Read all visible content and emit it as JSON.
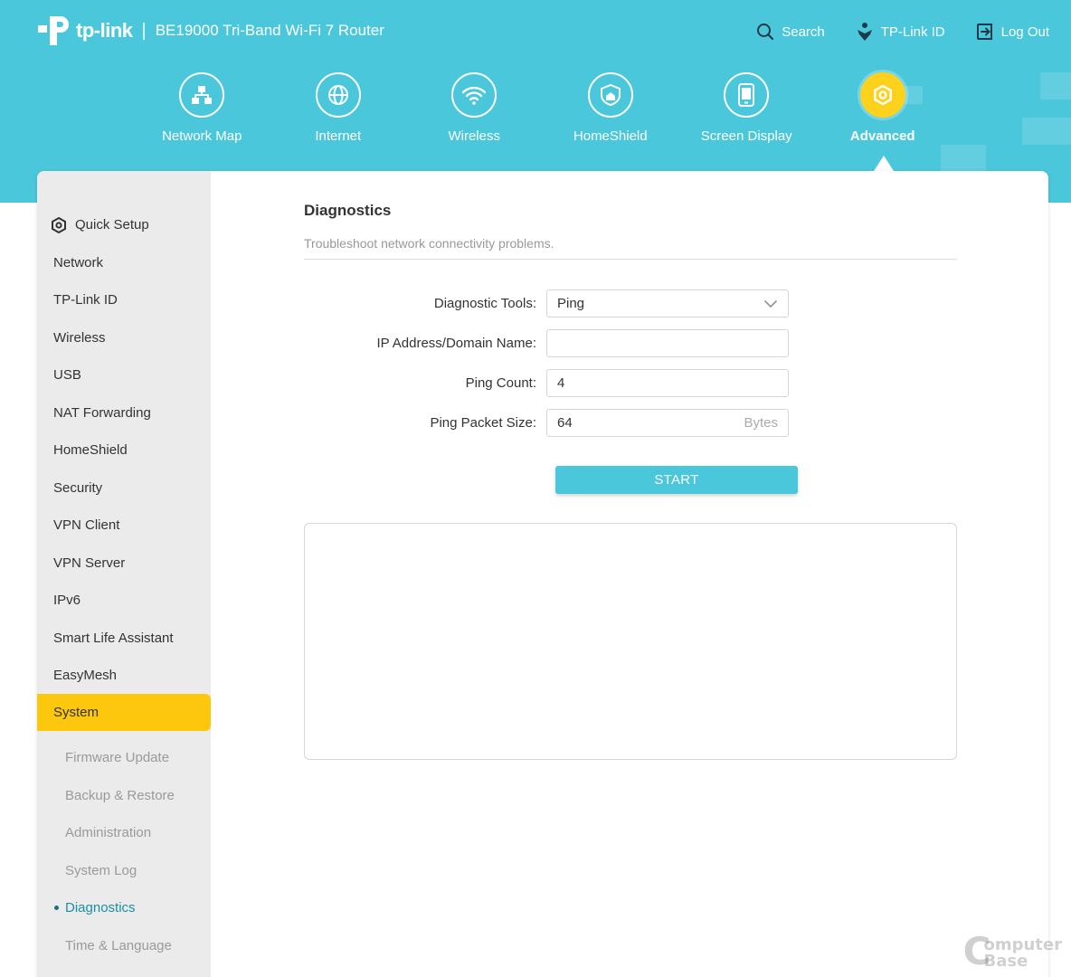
{
  "header": {
    "brand_name": "tp-link",
    "separator": "|",
    "model": "BE19000 Tri-Band Wi-Fi 7 Router",
    "links": [
      {
        "label": "Search",
        "icon": "search-icon"
      },
      {
        "label": "TP-Link ID",
        "icon": "tplink-id-icon"
      },
      {
        "label": "Log Out",
        "icon": "logout-icon"
      }
    ]
  },
  "nav": {
    "items": [
      {
        "label": "Network Map",
        "icon": "network-map-icon"
      },
      {
        "label": "Internet",
        "icon": "globe-icon"
      },
      {
        "label": "Wireless",
        "icon": "wifi-icon"
      },
      {
        "label": "HomeShield",
        "icon": "homeshield-icon"
      },
      {
        "label": "Screen Display",
        "icon": "screen-display-icon"
      },
      {
        "label": "Advanced",
        "icon": "gear-icon",
        "active": true
      }
    ]
  },
  "sidebar": {
    "items": [
      {
        "label": "Quick Setup",
        "icon": "quick-setup-icon"
      },
      {
        "label": "Network"
      },
      {
        "label": "TP-Link ID"
      },
      {
        "label": "Wireless"
      },
      {
        "label": "USB"
      },
      {
        "label": "NAT Forwarding"
      },
      {
        "label": "HomeShield"
      },
      {
        "label": "Security"
      },
      {
        "label": "VPN Client"
      },
      {
        "label": "VPN Server"
      },
      {
        "label": "IPv6"
      },
      {
        "label": "Smart Life Assistant"
      },
      {
        "label": "EasyMesh"
      },
      {
        "label": "System",
        "active": true
      }
    ],
    "subitems": [
      {
        "label": "Firmware Update"
      },
      {
        "label": "Backup & Restore"
      },
      {
        "label": "Administration"
      },
      {
        "label": "System Log"
      },
      {
        "label": "Diagnostics",
        "active": true
      },
      {
        "label": "Time & Language"
      }
    ]
  },
  "content": {
    "title": "Diagnostics",
    "description": "Troubleshoot network connectivity problems.",
    "form": {
      "tool_label": "Diagnostic Tools:",
      "tool_value": "Ping",
      "ip_label": "IP Address/Domain Name:",
      "ip_value": "",
      "count_label": "Ping Count:",
      "count_value": "4",
      "size_label": "Ping Packet Size:",
      "size_value": "64",
      "size_unit": "Bytes"
    },
    "start_label": "START",
    "result_text": ""
  },
  "watermark": {
    "letter": "C",
    "line1": "omputer",
    "line2": "Base"
  },
  "colors": {
    "header": "#4bc7dc",
    "accent": "#fcc70d",
    "sidebar": "#ebebeb",
    "active_link": "#1a8fa4"
  }
}
